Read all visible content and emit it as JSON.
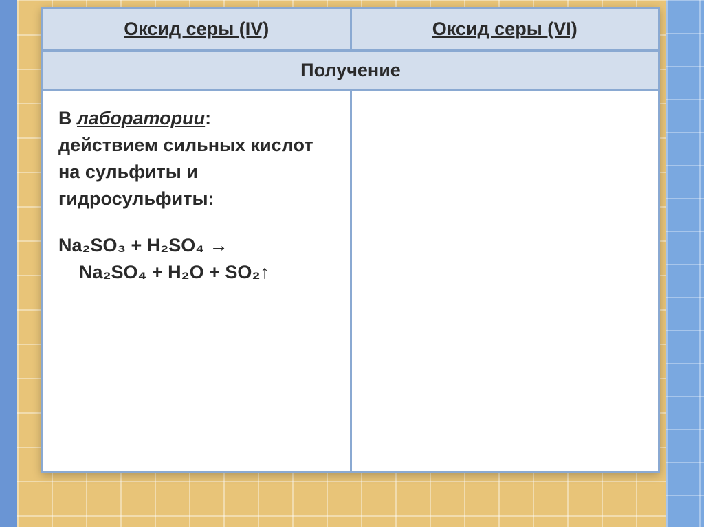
{
  "table": {
    "headers": {
      "left": "Оксид серы (IV)",
      "right": "Оксид серы (VI)"
    },
    "subheader": "Получение",
    "content": {
      "left": {
        "lab_prefix": "В ",
        "lab_label": "лаборатории",
        "lab_suffix": ":",
        "description": "действием сильных кислот на сульфиты и гидросульфиты:",
        "equation_line1": "Na₂SO₃ + H₂SO₄ →",
        "equation_line2": "Na₂SO₄ + H₂O + SO₂↑"
      },
      "right": ""
    }
  }
}
